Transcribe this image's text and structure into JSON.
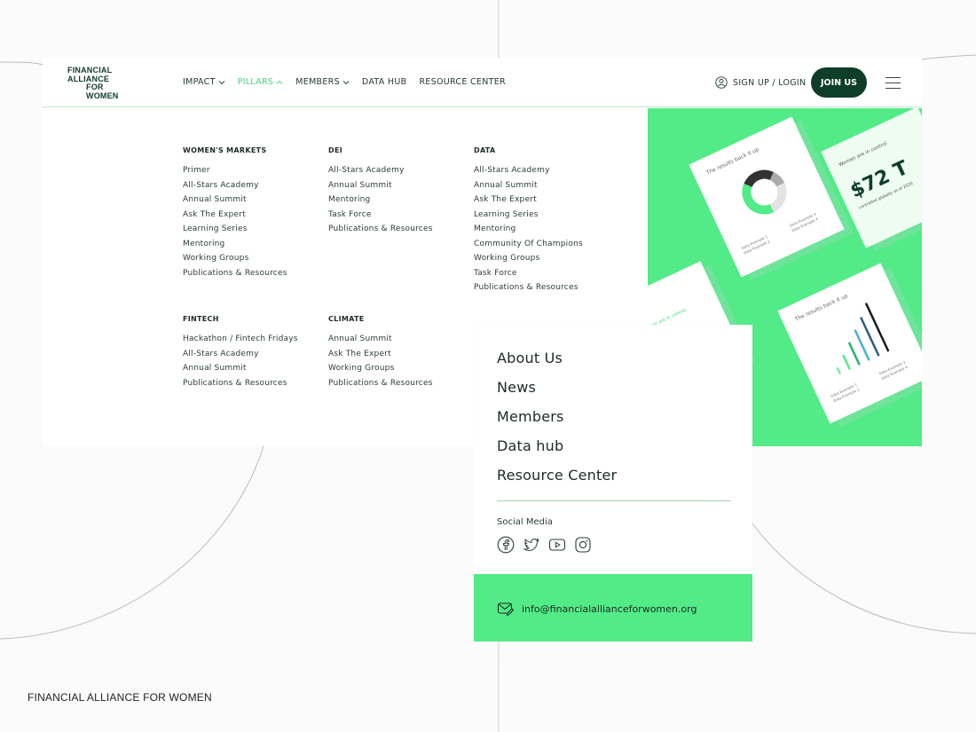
{
  "logo": {
    "lines": [
      "FINANCIAL",
      "ALLIANCE",
      "FOR",
      "WOMEN"
    ]
  },
  "nav": {
    "items": [
      {
        "label": "IMPACT",
        "has_caret": true
      },
      {
        "label": "PILLARS",
        "has_caret": true,
        "active": true
      },
      {
        "label": "MEMBERS",
        "has_caret": true
      },
      {
        "label": "DATA HUB"
      },
      {
        "label": "RESOURCE CENTER"
      }
    ],
    "signup_label": "SIGN UP / LOGIN",
    "join_label": "JOIN US"
  },
  "menu": {
    "categories": [
      {
        "title": "WOMEN'S MARKETS",
        "links": [
          "Primer",
          "All-Stars Academy",
          "Annual Summit",
          "Ask The Expert",
          "Learning Series",
          "Mentoring",
          "Working Groups",
          "Publications & Resources"
        ]
      },
      {
        "title": "DEI",
        "links": [
          "All-Stars Academy",
          "Annual Summit",
          "Mentoring",
          "Task Force",
          "Publications & Resources"
        ]
      },
      {
        "title": "DATA",
        "links": [
          "All-Stars Academy",
          "Annual Summit",
          "Ask The Expert",
          "Learning Series",
          "Mentoring",
          "Community Of Champions",
          "Working Groups",
          "Task Force",
          "Publications & Resources"
        ]
      },
      {
        "title": "FINTECH",
        "links": [
          "Hackathon / Fintech Fridays",
          "All-Stars Academy",
          "Annual Summit",
          "Publications & Resources"
        ]
      },
      {
        "title": "CLIMATE",
        "links": [
          "Annual Summit",
          "Ask The Expert",
          "Working Groups",
          "Publications & Resources"
        ]
      }
    ]
  },
  "hero": {
    "card1_title": "The results back it up",
    "card1_legend": [
      "Data Example 1",
      "Data Example 2",
      "Data Example 3",
      "Data Example 4"
    ],
    "card2_caption": "Women are in control.",
    "card2_value": "$72 T",
    "card2_sub": "controlled globally as of 2020",
    "card3_caption": "Women are in control.",
    "card4_title": "The results back it up",
    "card4_legend": [
      "Data Example 1",
      "Data Example 2",
      "Data Example 3",
      "Data Example 4"
    ]
  },
  "panel": {
    "links": [
      "About Us",
      "News",
      "Members",
      "Data hub",
      "Resource Center"
    ],
    "social_title": "Social Media",
    "social_icons": [
      "facebook-icon",
      "twitter-icon",
      "youtube-icon",
      "instagram-icon"
    ],
    "email": "info@financialallianceforwomen.org"
  },
  "footer_brand": "FINANCIAL ALLIANCE FOR WOMEN",
  "colors": {
    "green": "#52eb87",
    "dark_green": "#0e3e2a",
    "active_nav": "#45d27f"
  }
}
